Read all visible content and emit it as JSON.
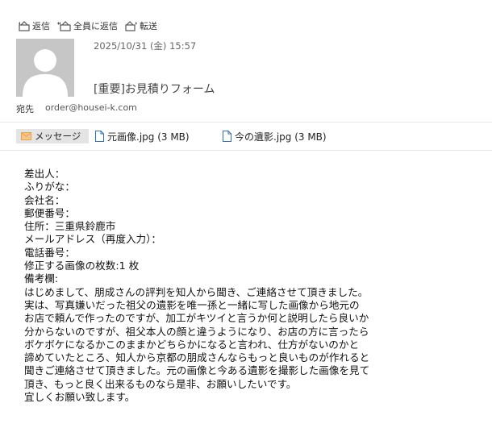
{
  "toolbar": {
    "reply_label": "返信",
    "reply_all_label": "全員に返信",
    "forward_label": "転送"
  },
  "header": {
    "date": "2025/10/31 (金) 15:57",
    "subject": "[重要]お見積りフォーム",
    "to_label": "宛先",
    "to_value": "order@housei-k.com"
  },
  "attachments_bar": {
    "message_tab": "メッセージ",
    "files": [
      {
        "name": "元画像.jpg (3 MB)"
      },
      {
        "name": "今の遺影.jpg (3 MB)"
      }
    ]
  },
  "body": {
    "lines": [
      "差出人：",
      "ふりがな：",
      "会社名：",
      "郵便番号：",
      "住所：三重県鈴鹿市",
      "メールアドレス（再度入力）：",
      "電話番号：",
      "修正する画像の枚数:1 枚",
      "備考欄:",
      "はじめまして、朋成さんの評判を知人から聞き、ご連絡させて頂きました。",
      "実は、写真嫌いだった祖父の遺影を唯一孫と一緒に写した画像から地元の",
      "お店で頼んで作ったのですが、加工がキツイと言うか何と説明したら良いか",
      "分からないのですが、祖父本人の顔と違うようになり、お店の方に言ったら",
      "ボケボケになるかこのままかどちらかになると言われ、仕方がないのかと",
      "諦めていたところ、知人から京都の朋成さんならもっと良いものが作れると",
      "聞きご連絡させて頂きました。元の画像と今ある遺影を撮影した画像を見て",
      "頂き、もっと良く出来るものなら是非、お願いしたいです。",
      "宜しくお願い致します。"
    ]
  },
  "colors": {
    "avatar_bg": "#c6c6c6",
    "message_tab_bg": "#e4e4e4",
    "envelope_accent": "#e8a24a",
    "file_icon": "#2f6fb5"
  }
}
